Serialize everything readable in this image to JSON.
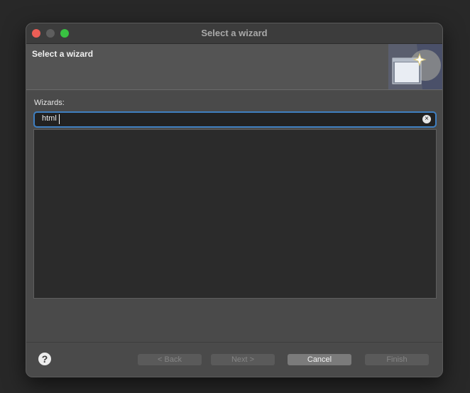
{
  "window": {
    "title": "Select a wizard"
  },
  "header": {
    "title": "Select a wizard"
  },
  "wizards": {
    "label": "Wizards:",
    "filter_value": "html",
    "items": []
  },
  "buttons": {
    "back": "< Back",
    "next": "Next >",
    "cancel": "Cancel",
    "finish": "Finish"
  },
  "help": {
    "glyph": "?"
  },
  "icons": {
    "clear": "clear-icon",
    "help": "help-icon",
    "banner": "wizard-banner-icon"
  },
  "colors": {
    "focus_ring": "#3f7fc1",
    "close": "#ec5e56",
    "zoom": "#39c242"
  }
}
